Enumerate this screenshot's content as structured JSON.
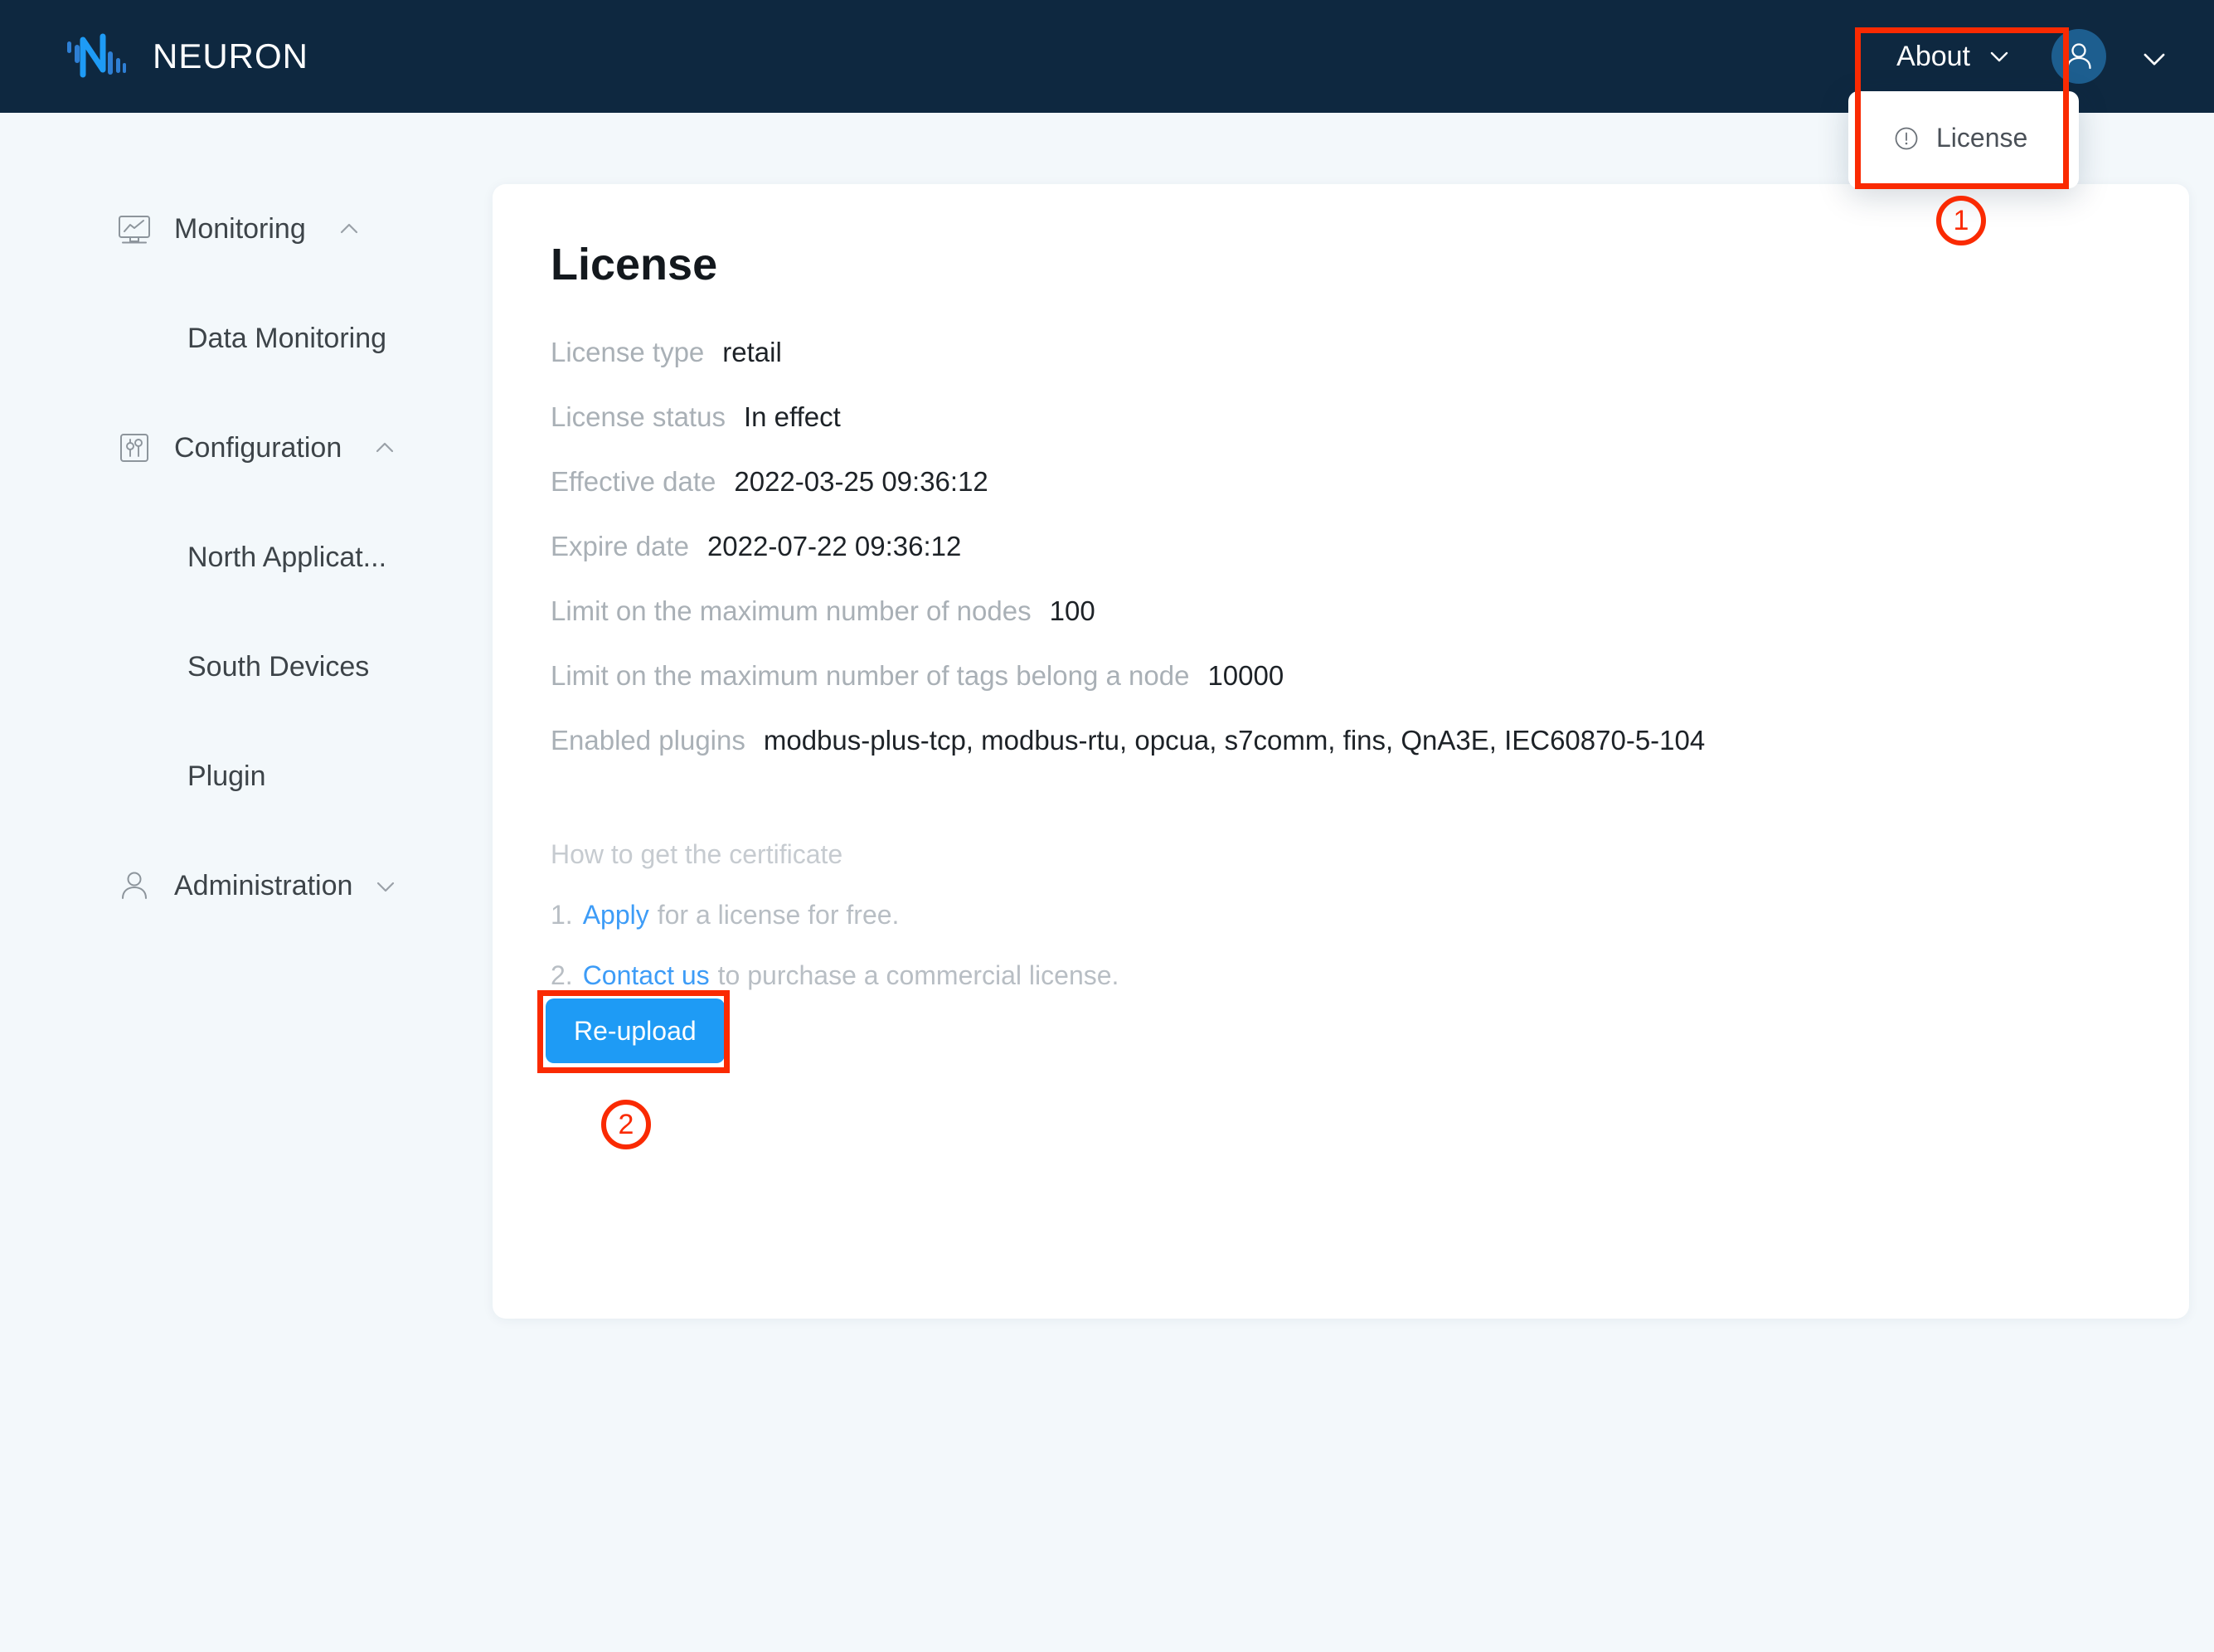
{
  "header": {
    "brand_name": "NEURON",
    "logo_icon": "neuron-logo-icon",
    "about_label": "About",
    "about_chevron_icon": "chevron-down-icon",
    "avatar_icon": "user-avatar-icon",
    "user_chevron_icon": "chevron-down-icon"
  },
  "about_dropdown": {
    "items": [
      {
        "label": "License",
        "icon": "exclamation-circle-icon"
      }
    ]
  },
  "sidebar": {
    "groups": [
      {
        "label": "Monitoring",
        "icon": "monitor-chart-icon",
        "chevron": "chevron-up-icon",
        "children": [
          {
            "label": "Data Monitoring"
          }
        ]
      },
      {
        "label": "Configuration",
        "icon": "sliders-icon",
        "chevron": "chevron-up-icon",
        "children": [
          {
            "label": "North Applicat..."
          },
          {
            "label": "South Devices"
          },
          {
            "label": "Plugin"
          }
        ]
      },
      {
        "label": "Administration",
        "icon": "user-outline-icon",
        "chevron": "chevron-down-icon",
        "children": []
      }
    ]
  },
  "main": {
    "title": "License",
    "details": [
      {
        "label": "License type",
        "value": "retail"
      },
      {
        "label": "License status",
        "value": "In effect"
      },
      {
        "label": "Effective date",
        "value": "2022-03-25 09:36:12"
      },
      {
        "label": "Expire date",
        "value": "2022-07-22 09:36:12"
      },
      {
        "label": "Limit on the maximum number of nodes",
        "value": "100"
      },
      {
        "label": "Limit on the maximum number of tags belong a node",
        "value": "10000"
      },
      {
        "label": "Enabled plugins",
        "value": "modbus-plus-tcp, modbus-rtu, opcua, s7comm, fins, QnA3E, IEC60870-5-104"
      }
    ],
    "howto": {
      "title": "How to get the certificate",
      "steps": [
        {
          "num": "1.",
          "link": "Apply",
          "rest": "for a license for free."
        },
        {
          "num": "2.",
          "link": "Contact us",
          "rest": "to purchase a commercial license."
        }
      ]
    },
    "reupload_label": "Re-upload"
  },
  "annotations": {
    "markers": [
      {
        "number": "1"
      },
      {
        "number": "2"
      }
    ],
    "highlight_color": "#fa2a02"
  },
  "colors": {
    "header_bg": "#0e2840",
    "page_bg": "#f3f8fb",
    "card_bg": "#ffffff",
    "accent_blue": "#1e9bf5",
    "link_blue": "#3d9cf7",
    "avatar_blue": "#1d5e8f"
  }
}
